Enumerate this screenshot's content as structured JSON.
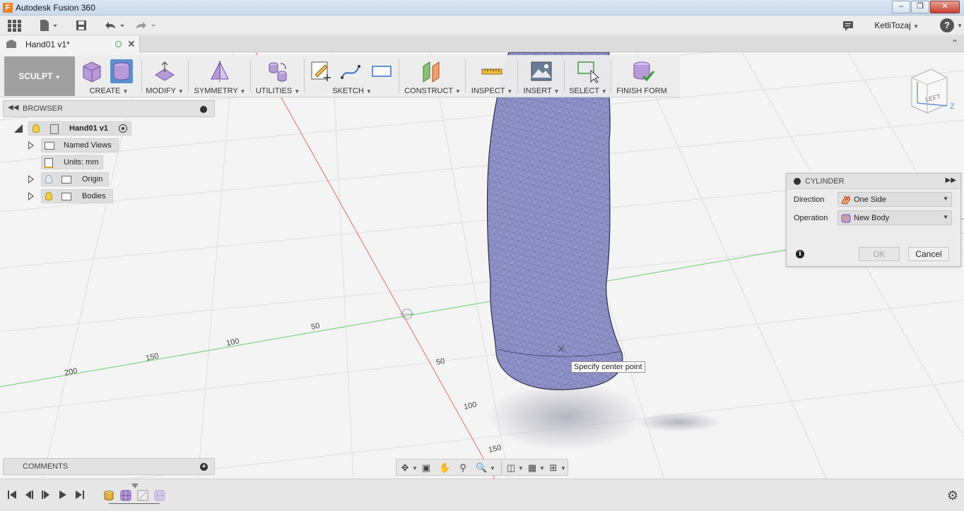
{
  "window": {
    "title": "Autodesk Fusion 360",
    "logo_letter": "F"
  },
  "qat": {
    "user_name": "KetliTozaj"
  },
  "document_tab": {
    "label": "Hand01 v1*"
  },
  "ribbon": {
    "workspace": "SCULPT",
    "groups": {
      "create": "CREATE",
      "modify": "MODIFY",
      "symmetry": "SYMMETRY",
      "utilities": "UTILITIES",
      "sketch": "SKETCH",
      "construct": "CONSTRUCT",
      "inspect": "INSPECT",
      "insert": "INSERT",
      "select": "SELECT",
      "finish_form": "FINISH FORM"
    }
  },
  "browser": {
    "title": "BROWSER",
    "root": "Hand01 v1",
    "items": {
      "named_views": "Named Views",
      "units": "Units: mm",
      "origin": "Origin",
      "bodies": "Bodies"
    }
  },
  "comments": {
    "title": "COMMENTS"
  },
  "cylinder_dialog": {
    "title": "CYLINDER",
    "direction_label": "Direction",
    "direction_value": "One Side",
    "operation_label": "Operation",
    "operation_value": "New Body",
    "ok_label": "OK",
    "cancel_label": "Cancel"
  },
  "tooltip": {
    "text": "Specify center point"
  },
  "viewcube": {
    "face": "LEFT",
    "axis_z": "Z"
  },
  "grid_labels": {
    "x_axis": [
      "50",
      "100",
      "150",
      "200"
    ],
    "y_axis": [
      "50",
      "100",
      "150"
    ]
  },
  "colors": {
    "body": "#8f93c8",
    "x_axis": "#60c060",
    "y_axis": "#e06060",
    "accent": "#5a8fd0"
  }
}
